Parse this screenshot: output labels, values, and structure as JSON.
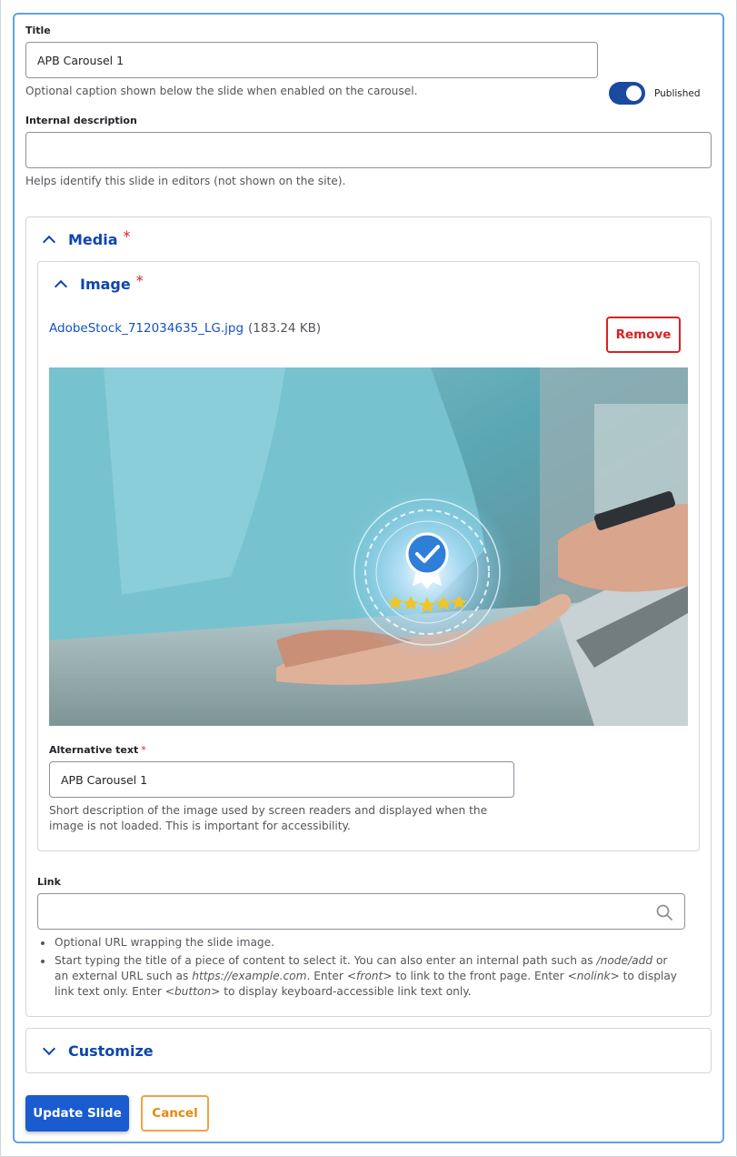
{
  "title_field": {
    "label": "Title",
    "value": "APB Carousel 1",
    "help": "Optional caption shown below the slide when enabled on the carousel."
  },
  "published_toggle": {
    "label": "Published",
    "checked": true
  },
  "internal_description": {
    "label": "Internal description",
    "value": "",
    "help": "Helps identify this slide in editors (not shown on the site)."
  },
  "media_section": {
    "summary": "Media",
    "required_mark": "*",
    "image": {
      "summary": "Image",
      "required_mark": "*",
      "file_name": "AdobeStock_712034635_LG.jpg",
      "file_size": "(183.24 KB)",
      "remove_label": "Remove",
      "alt_text": {
        "label": "Alternative text",
        "required_mark": "*",
        "value": "APB Carousel 1",
        "help": "Short description of the image used by screen readers and displayed when the image is not loaded. This is important for accessibility."
      }
    },
    "link": {
      "label": "Link",
      "value": "",
      "help_items": [
        "Optional URL wrapping the slide image.",
        "Start typing the title of a piece of content to select it. You can also enter an internal path such as",
        "/node/add",
        "or an external URL such as",
        "https://example.com",
        ". Enter",
        "<front>",
        "to link to the front page.",
        "Enter",
        "<nolink>",
        "to display link text only. Enter",
        "<button>",
        "to display keyboard-accessible link text only."
      ]
    }
  },
  "customize_section": {
    "summary": "Customize"
  },
  "actions": {
    "update_label": "Update Slide",
    "cancel_label": "Cancel"
  },
  "colors": {
    "accent": "#1a5ccf",
    "focus_border": "#5fa3e8",
    "danger": "#d72222",
    "warning": "#e8890c"
  },
  "icons": {
    "collapse_media": "chevron-up-icon",
    "collapse_image": "chevron-up-icon",
    "expand_customize": "chevron-down-icon",
    "link_search": "search-icon"
  }
}
